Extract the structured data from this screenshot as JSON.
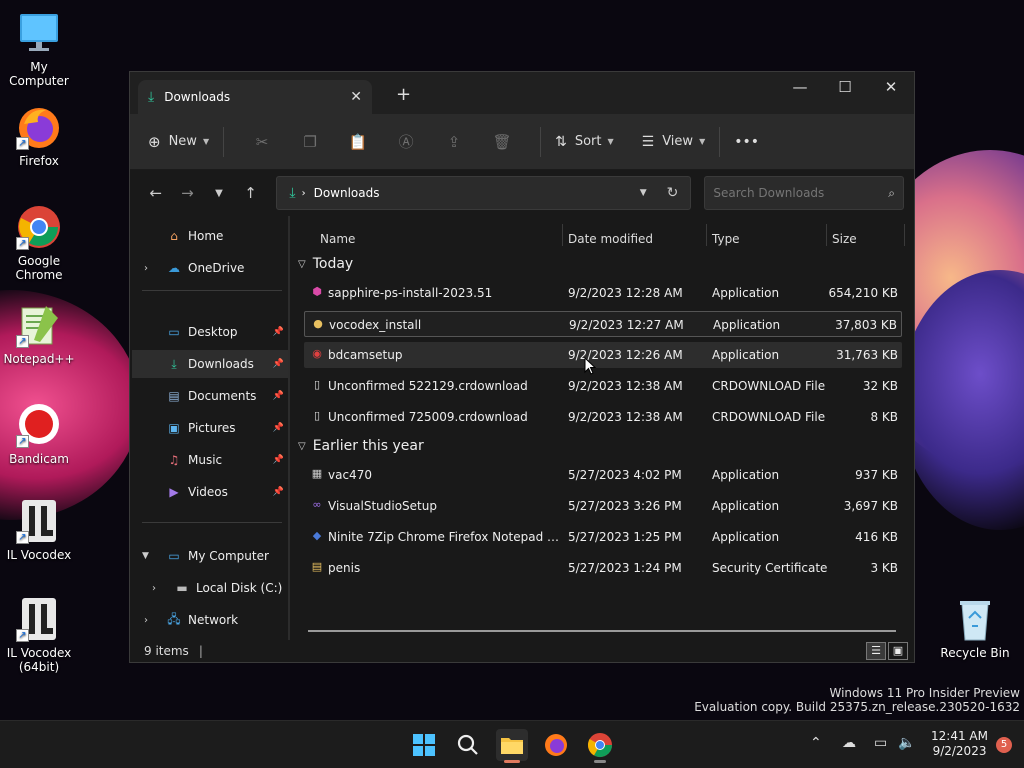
{
  "desktop": {
    "icons": [
      {
        "label": "My Computer"
      },
      {
        "label": "Firefox"
      },
      {
        "label": "Google Chrome"
      },
      {
        "label": "Notepad++"
      },
      {
        "label": "Bandicam"
      },
      {
        "label": "IL Vocodex"
      },
      {
        "label": "IL Vocodex (64bit)"
      },
      {
        "label": "Recycle Bin"
      }
    ]
  },
  "window": {
    "tab_title": "Downloads",
    "toolbar": {
      "new_label": "New",
      "sort_label": "Sort",
      "view_label": "View",
      "more_label": "•••"
    },
    "address": {
      "crumb": "Downloads",
      "search_placeholder": "Search Downloads"
    },
    "sidebar": {
      "items": [
        {
          "label": "Home"
        },
        {
          "label": "OneDrive"
        },
        {
          "label": "Desktop"
        },
        {
          "label": "Downloads"
        },
        {
          "label": "Documents"
        },
        {
          "label": "Pictures"
        },
        {
          "label": "Music"
        },
        {
          "label": "Videos"
        },
        {
          "label": "My Computer"
        },
        {
          "label": "Local Disk (C:)"
        },
        {
          "label": "Network"
        }
      ]
    },
    "columns": {
      "name": "Name",
      "date": "Date modified",
      "type": "Type",
      "size": "Size"
    },
    "groups": [
      {
        "title": "Today",
        "files": [
          {
            "name": "sapphire-ps-install-2023.51",
            "date": "9/2/2023 12:28 AM",
            "type": "Application",
            "size": "654,210 KB"
          },
          {
            "name": "vocodex_install",
            "date": "9/2/2023 12:27 AM",
            "type": "Application",
            "size": "37,803 KB"
          },
          {
            "name": "bdcamsetup",
            "date": "9/2/2023 12:26 AM",
            "type": "Application",
            "size": "31,763 KB"
          },
          {
            "name": "Unconfirmed 522129.crdownload",
            "date": "9/2/2023 12:38 AM",
            "type": "CRDOWNLOAD File",
            "size": "32 KB"
          },
          {
            "name": "Unconfirmed 725009.crdownload",
            "date": "9/2/2023 12:38 AM",
            "type": "CRDOWNLOAD File",
            "size": "8 KB"
          }
        ]
      },
      {
        "title": "Earlier this year",
        "files": [
          {
            "name": "vac470",
            "date": "5/27/2023 4:02 PM",
            "type": "Application",
            "size": "937 KB"
          },
          {
            "name": "VisualStudioSetup",
            "date": "5/27/2023 3:26 PM",
            "type": "Application",
            "size": "3,697 KB"
          },
          {
            "name": "Ninite 7Zip Chrome Firefox Notepad Inst...",
            "date": "5/27/2023 1:25 PM",
            "type": "Application",
            "size": "416 KB"
          },
          {
            "name": "penis",
            "date": "5/27/2023 1:24 PM",
            "type": "Security Certificate",
            "size": "3 KB"
          }
        ]
      }
    ],
    "status": {
      "items": "9 items"
    }
  },
  "watermark": {
    "line1": "Windows 11 Pro Insider Preview",
    "line2": "Evaluation copy. Build 25375.zn_release.230520-1632"
  },
  "taskbar": {
    "time": "12:41 AM",
    "date": "9/2/2023",
    "badge": "5"
  }
}
